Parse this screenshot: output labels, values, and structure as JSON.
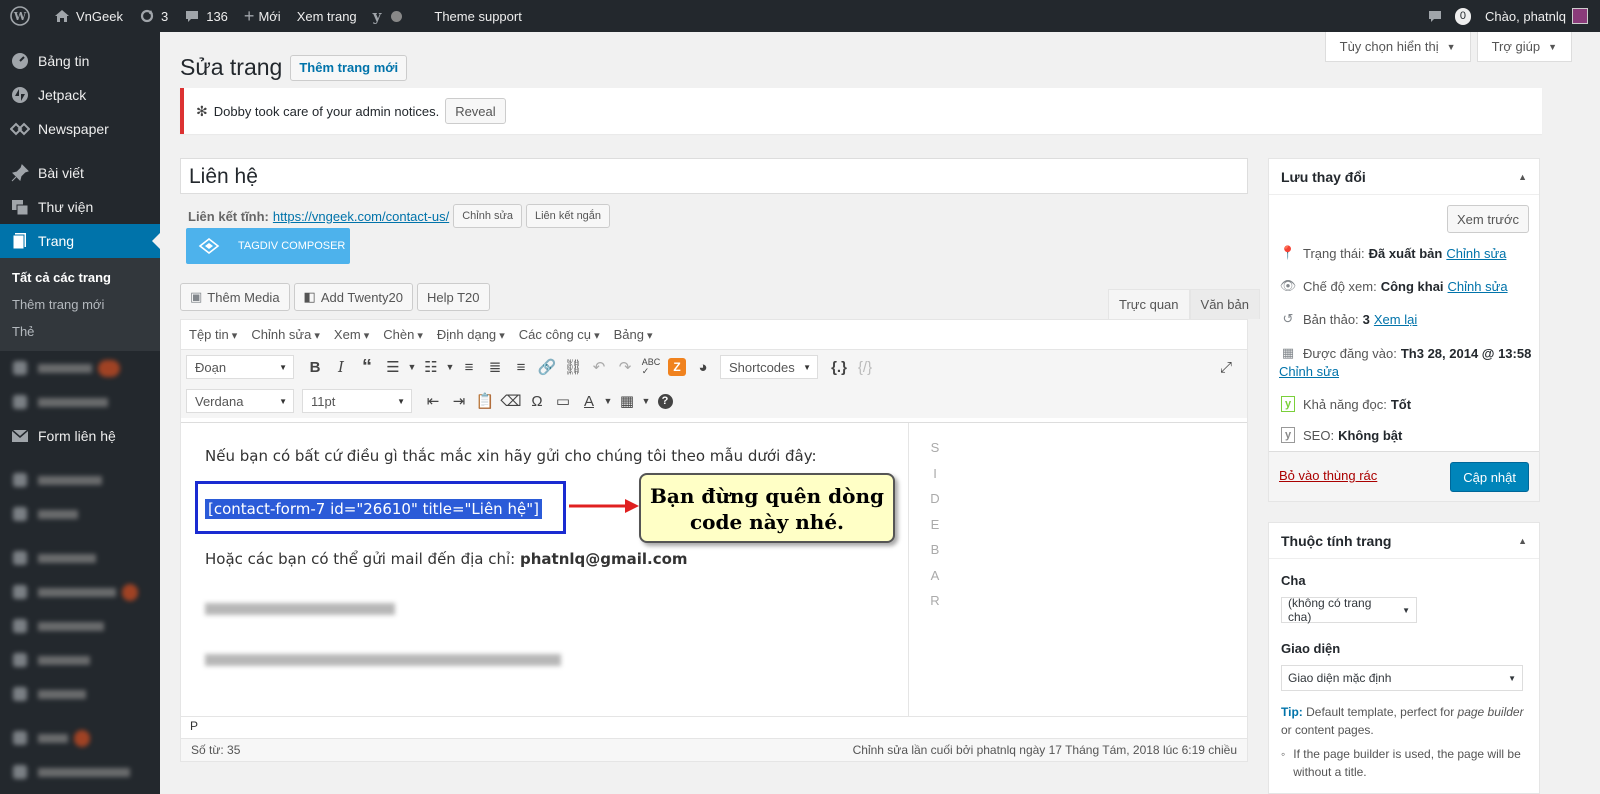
{
  "adminbar": {
    "site_name": "VnGeek",
    "updates_count": "3",
    "comments_count": "136",
    "new_label": "Mới",
    "view_page_label": "Xem trang",
    "theme_support_label": "Theme support",
    "notif_count": "0",
    "greeting": "Chào, phatnlq"
  },
  "sidebar": {
    "items": [
      {
        "label": "Bảng tin",
        "icon": "dashboard-icon"
      },
      {
        "label": "Jetpack",
        "icon": "jetpack-icon"
      },
      {
        "label": "Newspaper",
        "icon": "newspaper-icon"
      },
      {
        "label": "Bài viết",
        "icon": "pin-icon"
      },
      {
        "label": "Thư viện",
        "icon": "media-icon"
      },
      {
        "label": "Trang",
        "icon": "pages-icon"
      }
    ],
    "submenu": [
      "Tất cả các trang",
      "Thêm trang mới",
      "Thẻ"
    ],
    "form_label": "Form liên hệ"
  },
  "screen": {
    "options_label": "Tùy chọn hiển thị",
    "help_label": "Trợ giúp"
  },
  "page": {
    "title": "Sửa trang",
    "add_new_label": "Thêm trang mới"
  },
  "notice": {
    "text": "Dobby took care of your admin notices.",
    "reveal_label": "Reveal"
  },
  "post": {
    "title": "Liên hệ",
    "permalink_label": "Liên kết tĩnh:",
    "permalink_url": "https://vngeek.com/contact-us/",
    "edit_label": "Chỉnh sửa",
    "shortlink_label": "Liên kết ngắn",
    "tagdiv_label": "TAGDIV COMPOSER"
  },
  "media_buttons": [
    "Thêm Media",
    "Add Twenty20",
    "Help T20"
  ],
  "editor_tabs": {
    "visual": "Trực quan",
    "text": "Văn bản"
  },
  "menubar": [
    "Tệp tin",
    "Chỉnh sửa",
    "Xem",
    "Chèn",
    "Định dạng",
    "Các công cụ",
    "Bảng"
  ],
  "toolbar": {
    "format_select": "Đoạn",
    "shortcodes_select": "Shortcodes",
    "font_select": "Verdana",
    "size_select": "11pt"
  },
  "content": {
    "line1": "Nếu bạn có bất cứ điều gì thắc mắc xin hãy gửi cho chúng tôi theo mẫu dưới đây:",
    "shortcode": "[contact-form-7 id=\"26610\" title=\"Liên hệ\"]",
    "line2_prefix": "Hoặc các bạn có thể gửi mail đến địa chỉ: ",
    "line2_email": "phatnlq@gmail.com",
    "sidebar_letters": [
      "S",
      "I",
      "D",
      "E",
      "B",
      "A",
      "R"
    ],
    "callout_line1": "Bạn đừng quên dòng",
    "callout_line2": "code này nhé."
  },
  "statusbar": {
    "path": "P",
    "word_count": "Số từ: 35",
    "last_edit": "Chỉnh sửa lần cuối bởi phatnlq ngày 17 Tháng Tám, 2018 lúc 6:19 chiều"
  },
  "publish": {
    "title": "Lưu thay đổi",
    "preview_label": "Xem trước",
    "status_label": "Trạng thái:",
    "status_value": "Đã xuất bản",
    "visibility_label": "Chế độ xem:",
    "visibility_value": "Công khai",
    "revisions_label": "Bản thảo:",
    "revisions_value": "3",
    "revisions_link": "Xem lại",
    "published_label": "Được đăng vào:",
    "published_value": "Th3 28, 2014 @ 13:58",
    "edit_link": "Chỉnh sửa",
    "readability_label": "Khả năng đọc:",
    "readability_value": "Tốt",
    "seo_label": "SEO:",
    "seo_value": "Không bật",
    "trash_label": "Bỏ vào thùng rác",
    "update_label": "Cập nhật"
  },
  "attributes": {
    "title": "Thuộc tính trang",
    "parent_label": "Cha",
    "parent_value": "(không có trang cha)",
    "template_label": "Giao diện",
    "template_value": "Giao diện mặc định",
    "tip_label": "Tip:",
    "tip_text1": " Default template, perfect for ",
    "tip_em1": "page builder",
    "tip_text2": "or content pages.",
    "bullet": "If the page builder is used, the page will be without a title."
  },
  "colors": {
    "accent": "#0073aa",
    "adminbar": "#23282d",
    "notice_border": "#dc3232"
  }
}
